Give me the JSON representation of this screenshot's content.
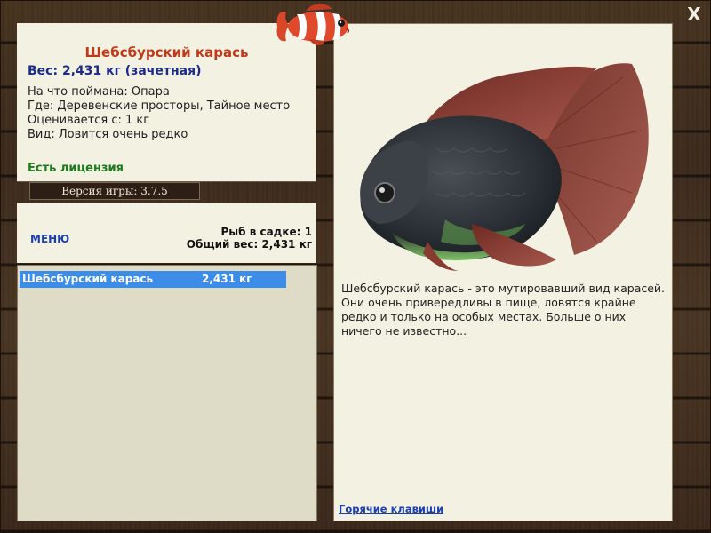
{
  "fish": {
    "title": "Шебсбурский карась",
    "weight_line": "Вес: 2,431 кг (зачетная)",
    "details": [
      "На что поймана: Опара",
      "Где: Деревенские просторы, Тайное место",
      "Оценивается с: 1 кг",
      "Вид: Ловится очень редко"
    ],
    "license": "Есть лицензия",
    "description": "Шебсбурский карась - это мутировавший вид карасей. Они очень привередливы в пище, ловятся крайне редко и только на особых местах. Больше о них ничего не известно..."
  },
  "version": "Версия игры: 3.7.5",
  "cage": {
    "menu_label": "МЕНЮ",
    "count_text": "Рыб в садке: 1",
    "total_weight_text": "Общий вес: 2,431 кг"
  },
  "catch_list": [
    {
      "name": "Шебсбурский карась",
      "weight": "2,431 кг"
    }
  ],
  "hotkeys_label": "Горячие клавиши",
  "close_label": "X",
  "colors": {
    "title": "#c0391a",
    "weight": "#1b2a8c",
    "license": "#1d7a1d",
    "link": "#1b3fb8",
    "selection": "#3b8de8",
    "panel": "#f3f1e1"
  },
  "icons": {
    "logo": "clownfish-logo-icon",
    "close": "close-icon"
  }
}
